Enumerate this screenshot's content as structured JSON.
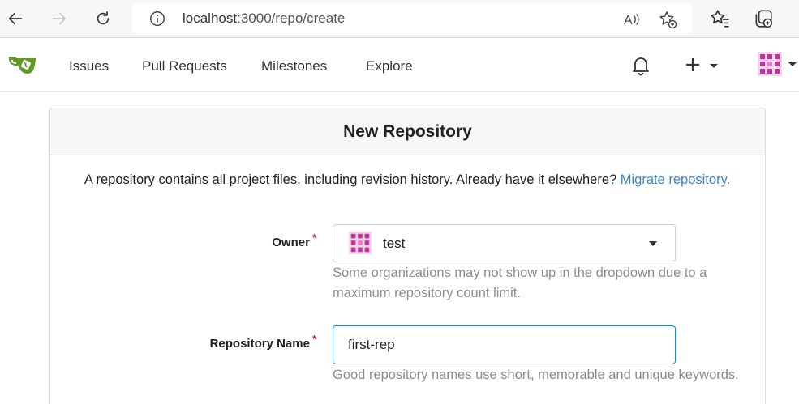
{
  "browser": {
    "url_host": "localhost",
    "url_rest": ":3000/repo/create"
  },
  "navbar": {
    "links": [
      "Issues",
      "Pull Requests",
      "Milestones",
      "Explore"
    ]
  },
  "page": {
    "title": "New Repository",
    "intro_text": "A repository contains all project files, including revision history. Already have it elsewhere?",
    "migrate_link": "Migrate repository."
  },
  "form": {
    "owner_label": "Owner",
    "owner_value": "test",
    "owner_help": "Some organizations may not show up in the dropdown due to a maximum repository count limit.",
    "repo_name_label": "Repository Name",
    "repo_name_value": "first-rep",
    "repo_name_help": "Good repository names use short, memorable and unique keywords.",
    "required_mark": "*"
  },
  "colors": {
    "link": "#4183c4",
    "logo_green": "#609926",
    "avatar_pink": "#c2349a",
    "required": "#db2828",
    "focus_border": "#2185d0"
  }
}
